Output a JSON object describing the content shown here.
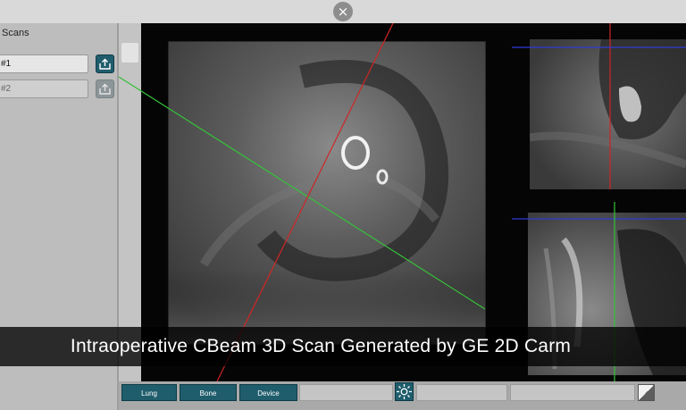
{
  "top": {
    "close_icon": "×"
  },
  "sidebar": {
    "title": "Scans",
    "scans": [
      {
        "label": "#1",
        "active": true
      },
      {
        "label": "#2",
        "active": false
      }
    ]
  },
  "toolbar": {
    "presets": [
      "Lung",
      "Bone",
      "Device"
    ],
    "brightness_icon": "brightness-icon",
    "contrast_icon": "contrast-icon"
  },
  "caption": "Intraoperative CBeam 3D Scan Generated by GE 2D Carm",
  "colors": {
    "accent": "#1f5d6c",
    "crosshair_red": "#d12525",
    "crosshair_green": "#36c13a",
    "crosshair_blue": "#2f3bd6"
  }
}
